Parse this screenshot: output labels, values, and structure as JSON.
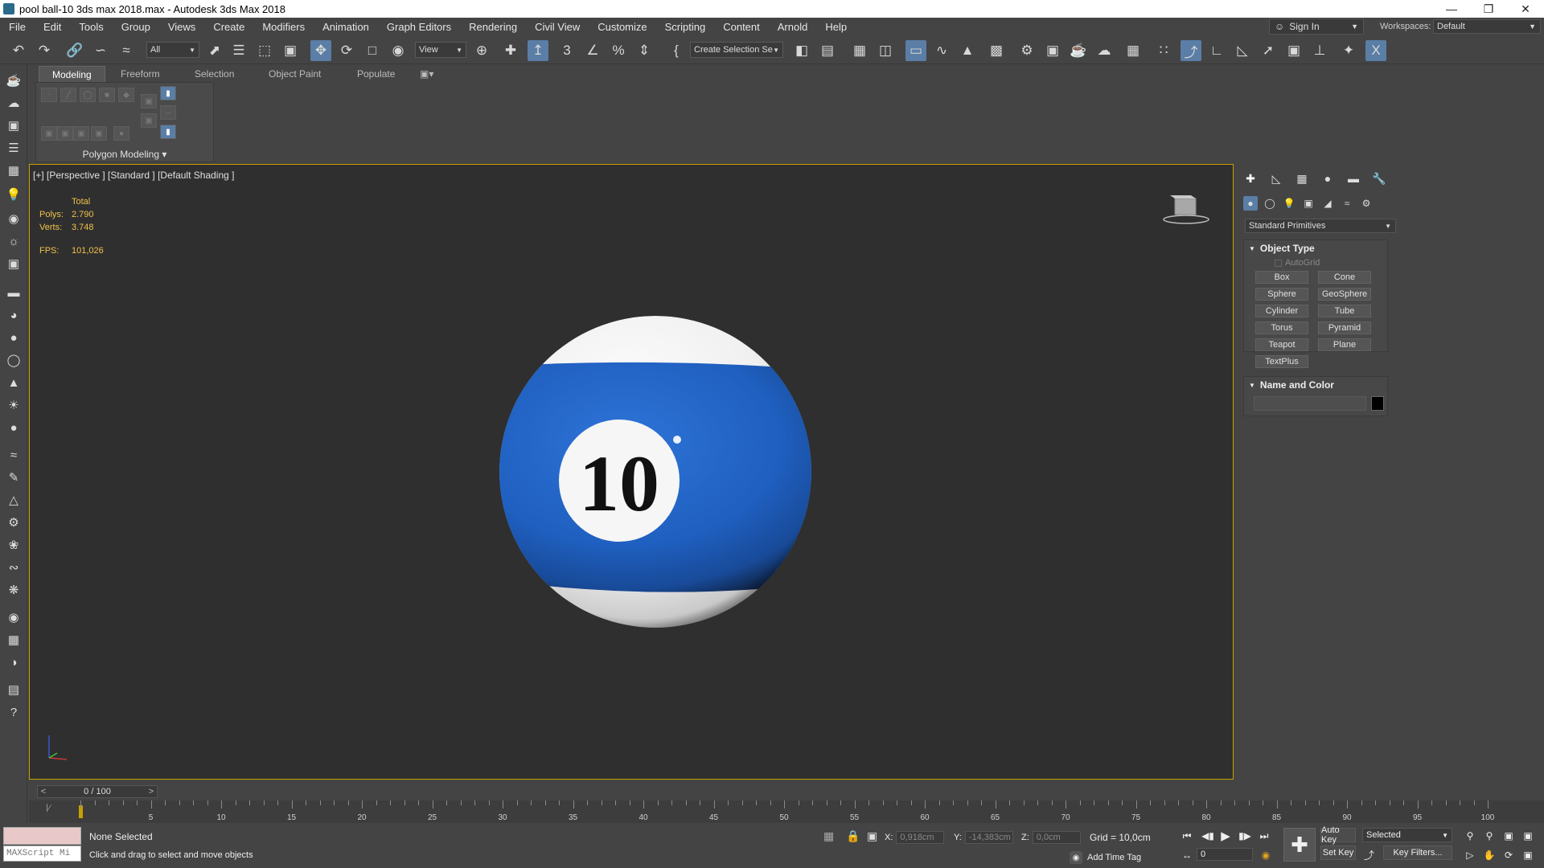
{
  "window": {
    "title": "pool ball-10 3ds max 2018.max - Autodesk 3ds Max 2018"
  },
  "menu": [
    "File",
    "Edit",
    "Tools",
    "Group",
    "Views",
    "Create",
    "Modifiers",
    "Animation",
    "Graph Editors",
    "Rendering",
    "Civil View",
    "Customize",
    "Scripting",
    "Content",
    "Arnold",
    "Help"
  ],
  "account": {
    "signin": "Sign In",
    "workspaces_label": "Workspaces:",
    "workspace": "Default"
  },
  "toolbar": {
    "filter": "All",
    "refcoord": "View",
    "selection_set": "Create Selection Se"
  },
  "ribbon": {
    "tabs": [
      "Modeling",
      "Freeform",
      "Selection",
      "Object Paint",
      "Populate"
    ],
    "active_tab": "Modeling",
    "panel_label": "Polygon Modeling"
  },
  "viewport": {
    "label": "[+] [Perspective ] [Standard ] [Default Shading ]",
    "stats": {
      "header": "Total",
      "polys_label": "Polys:",
      "polys": "2.790",
      "verts_label": "Verts:",
      "verts": "3.748",
      "fps_label": "FPS:",
      "fps": "101,026"
    },
    "ball_number": "10",
    "ball_colors": {
      "stripe": "#1f5fbf",
      "white": "#f2f2f2"
    }
  },
  "command_panel": {
    "category": "Standard Primitives",
    "object_type": {
      "header": "Object Type",
      "autogrid": "AutoGrid",
      "buttons": [
        "Box",
        "Cone",
        "Sphere",
        "GeoSphere",
        "Cylinder",
        "Tube",
        "Torus",
        "Pyramid",
        "Teapot",
        "Plane",
        "TextPlus"
      ]
    },
    "name_color": {
      "header": "Name and Color"
    }
  },
  "timeline": {
    "position": "0 / 100",
    "ticks": [
      "5",
      "10",
      "15",
      "20",
      "25",
      "30",
      "35",
      "40",
      "45",
      "50",
      "55",
      "60",
      "65",
      "70",
      "75",
      "80",
      "85",
      "90",
      "95",
      "100"
    ]
  },
  "status": {
    "maxscript": "MAXScript Mi",
    "selection": "None Selected",
    "prompt": "Click and drag to select and move objects",
    "x_label": "X:",
    "x": "0,918cm",
    "y_label": "Y:",
    "y": "-14,383cm",
    "z_label": "Z:",
    "z": "0,0cm",
    "grid": "Grid = 10,0cm",
    "add_time_tag": "Add Time Tag",
    "auto_key": "Auto Key",
    "set_key": "Set Key",
    "key_mode": "Selected",
    "key_filters": "Key Filters...",
    "frame": "0"
  }
}
